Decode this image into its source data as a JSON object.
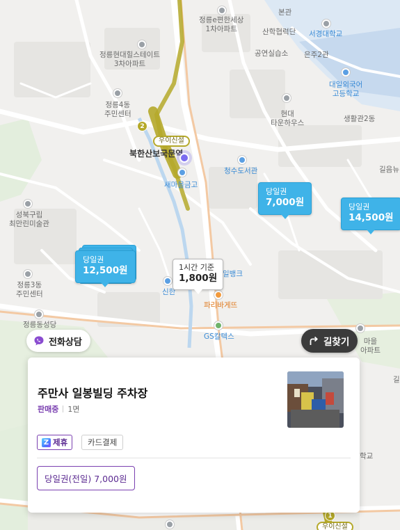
{
  "map": {
    "labels": {
      "jeongneung_e_apt": "정릉e편한세상\n1차아파트",
      "bonkwon": "본관",
      "seogyeong_univ": "서경대학교",
      "industry_coop": "산학협력단",
      "performance_hall": "공연실습소",
      "eunju_hall": "은주2관",
      "hyundai_apt": "정릉현대힐스테이트\n3차아파트",
      "daeil_school": "대일외국어\n고등학교",
      "jeongneung4_center": "정릉4동\n주민센터",
      "hyundai_town": "현대\n타운하우스",
      "living_hall": "생활관2동",
      "station": "북한산보국문역",
      "line_name": "우이신설",
      "saemaeul": "새마을금고",
      "library": "청수도서관",
      "gilum": "길음뉴",
      "seongbuk_museum": "성북구립\n최만린미술관",
      "jeongneung3_center": "정릉3동\n주민센터",
      "shinhan": "신한",
      "bank": "일뱅크",
      "paris": "파리바게뜨",
      "jeongneung_dong": "정릉동성당",
      "gs": "GS칼텍스",
      "apt_right": "마을\n아파트",
      "gil": "길",
      "hakgyo": "학교",
      "line_badge": "2",
      "bottom_badge": "1",
      "bottom_station": "우이신설"
    },
    "markers": [
      {
        "type": "당일권",
        "price": "7,000원"
      },
      {
        "type": "당일권",
        "price": "14,500원"
      },
      {
        "type": "당일권",
        "price": "12,500원"
      }
    ],
    "selected_marker": {
      "type": "1시간 기준",
      "price": "1,800원"
    }
  },
  "phone_button": {
    "label": "전화상담",
    "icon": "phone-chat-icon"
  },
  "route_button": {
    "label": "길찾기",
    "icon": "route-arrow-icon"
  },
  "card": {
    "name": "주만사 일봉빌딩 주차장",
    "status": "판매중",
    "slots": "1면",
    "tags": {
      "partner": "제휴",
      "partner_icon": "Z",
      "card_payment": "카드결제"
    },
    "pass_button": "당일권(전일) 7,000원"
  },
  "colors": {
    "accent": "#7a3fb0",
    "marker": "#3fb3e8",
    "subway_line": "#b5a92a"
  }
}
